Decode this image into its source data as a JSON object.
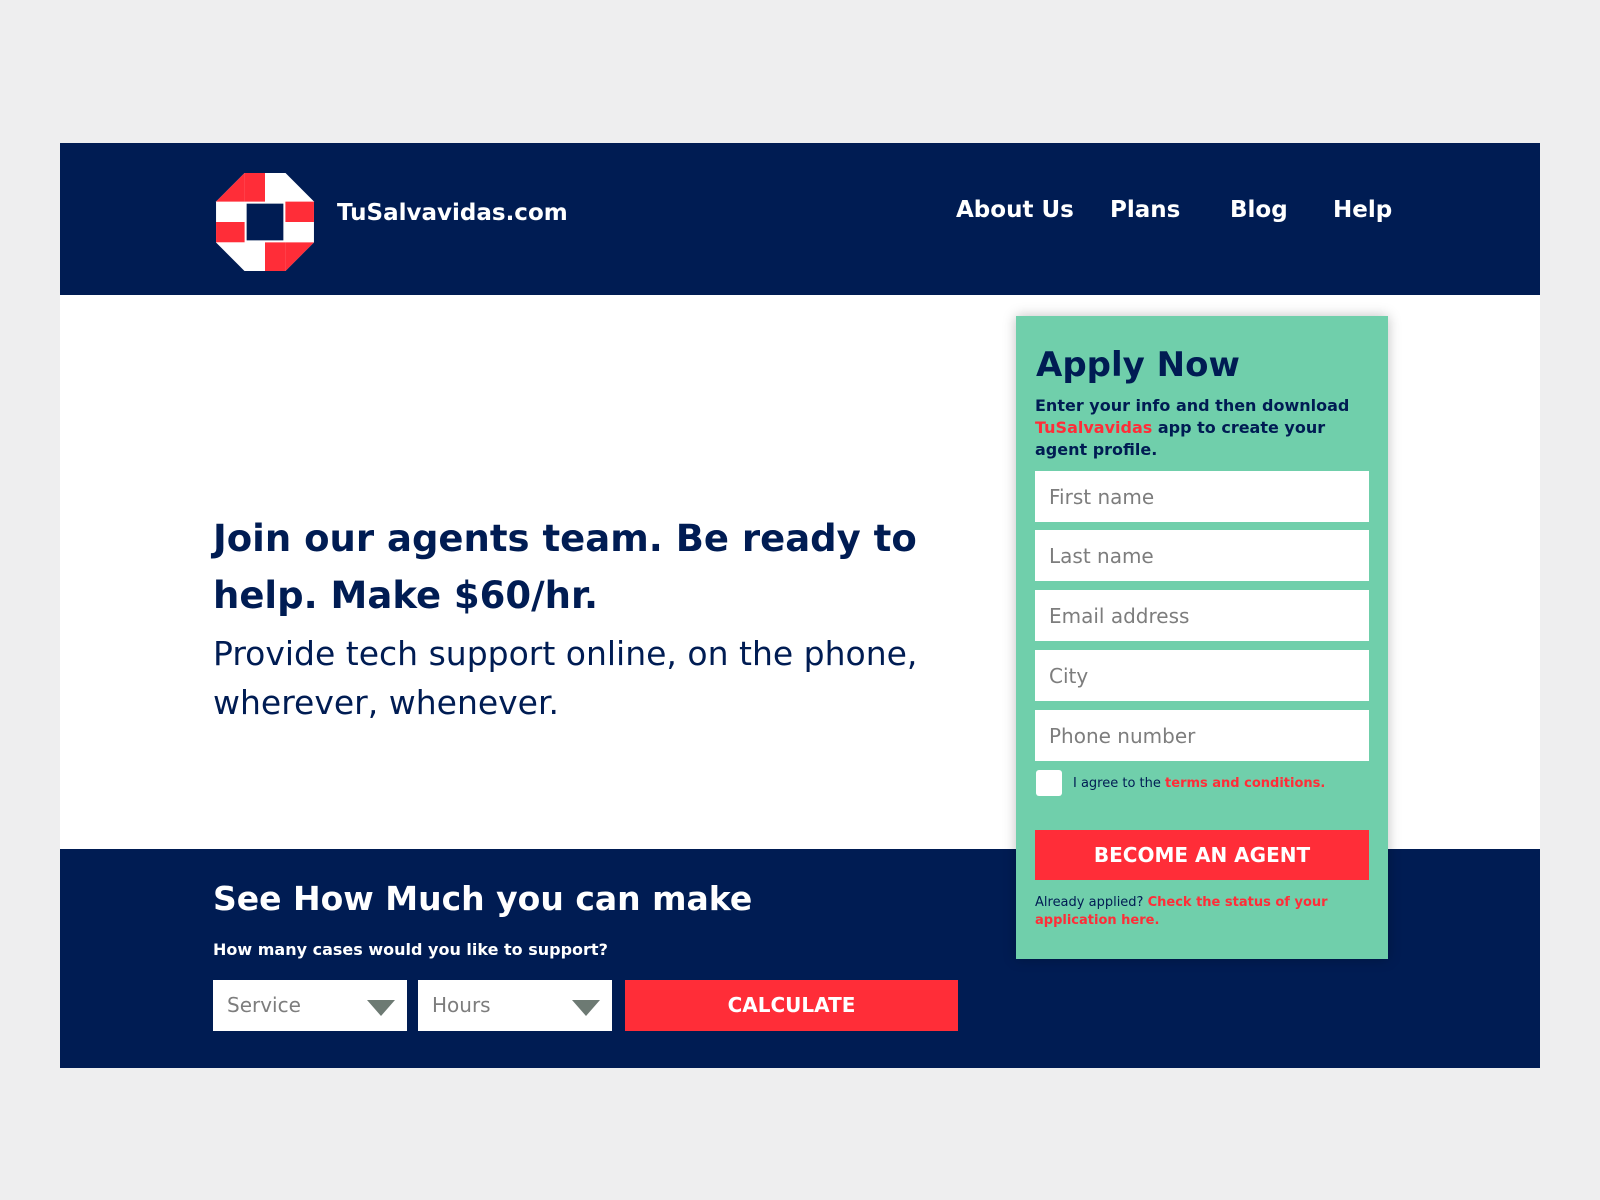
{
  "header": {
    "brand": "TuSalvavidas.com",
    "nav": [
      {
        "label": "About Us"
      },
      {
        "label": "Plans"
      },
      {
        "label": "Blog"
      },
      {
        "label": "Help"
      }
    ]
  },
  "hero": {
    "title": "Join our agents team. Be ready to help. Make $60/hr.",
    "subtitle": "Provide tech support online, on the phone, wherever, whenever."
  },
  "calculator": {
    "title": "See How Much you can make",
    "question": "How many cases would you like to support?",
    "service_value": "Service",
    "hours_value": "Hours",
    "calculate_label": "CALCULATE"
  },
  "apply": {
    "title": "Apply Now",
    "desc_part1": "Enter your info and  then download",
    "desc_brand": "TuSalvavidas",
    "desc_part2": "app to create your agent profile.",
    "first_name_placeholder": "First name",
    "last_name_placeholder": "Last name",
    "email_placeholder": "Email address",
    "city_placeholder": "City",
    "phone_placeholder": "Phone number",
    "agree_text": "I agree to the",
    "agree_link": "terms and conditions.",
    "submit_label": "BECOME AN AGENT",
    "already_text": "Already applied?",
    "already_link": "Check the status of your application here."
  },
  "colors": {
    "navy": "#001c53",
    "red": "#ff2d38",
    "mint": "#70cfab",
    "background": "#eeeeef"
  },
  "icons": {
    "logo": "lifebuoy-octagon-icon",
    "dropdown": "chevron-down-icon"
  }
}
